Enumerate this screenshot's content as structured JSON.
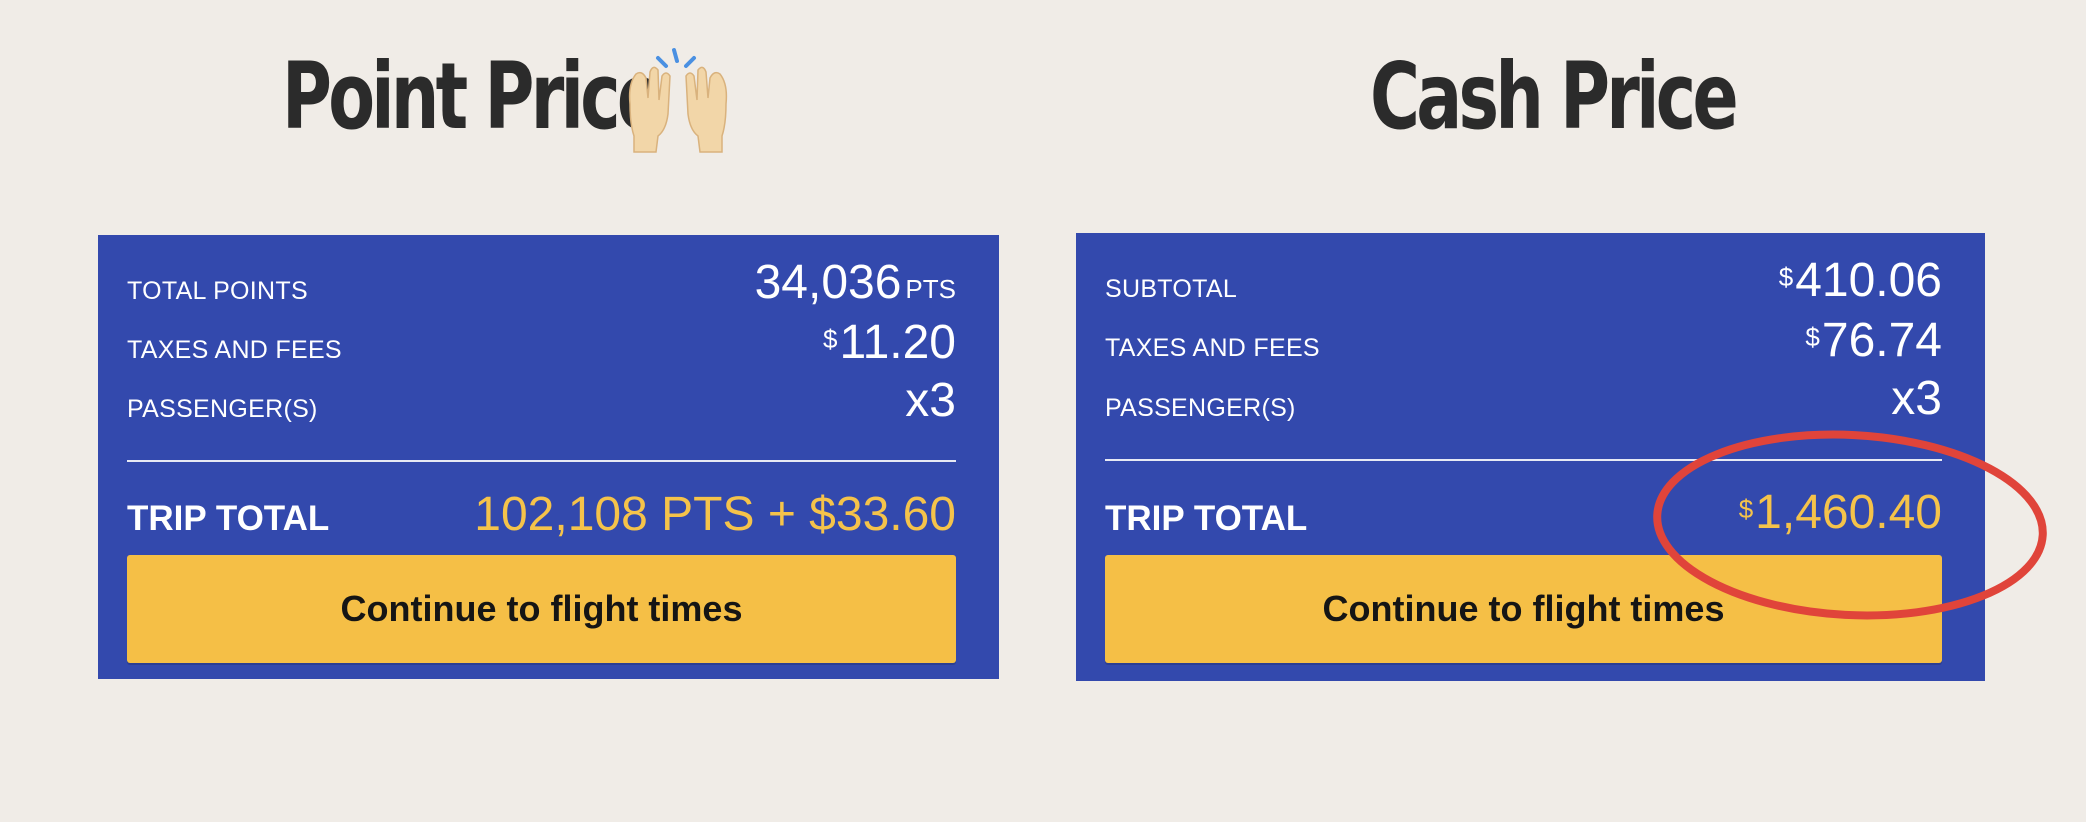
{
  "headings": {
    "point_price": "Point Price",
    "cash_price": "Cash Price",
    "emoji_icon": "raising-hands-icon"
  },
  "point_card": {
    "rows": [
      {
        "label": "TOTAL POINTS",
        "value": "34,036",
        "unit": "PTS"
      },
      {
        "label": "TAXES AND FEES",
        "currency": "$",
        "value": "11.20"
      },
      {
        "label": "PASSENGER(S)",
        "value": "x3"
      }
    ],
    "total_label": "TRIP TOTAL",
    "total_value": "102,108 PTS + $33.60",
    "button_label": "Continue to flight times"
  },
  "cash_card": {
    "rows": [
      {
        "label": "SUBTOTAL",
        "currency": "$",
        "value": "410.06"
      },
      {
        "label": "TAXES AND FEES",
        "currency": "$",
        "value": "76.74"
      },
      {
        "label": "PASSENGER(S)",
        "value": "x3"
      }
    ],
    "total_label": "TRIP TOTAL",
    "total_currency": "$",
    "total_value": "1,460.40",
    "button_label": "Continue to flight times"
  },
  "colors": {
    "page_background": "#f0ece7",
    "card_background": "#3349ad",
    "accent_yellow": "#f5c34a",
    "button_yellow": "#f5bf46",
    "annotation_red": "#e0443a"
  }
}
